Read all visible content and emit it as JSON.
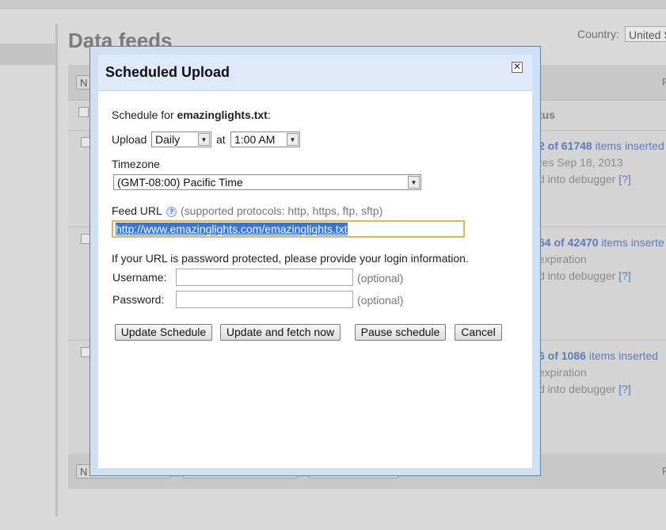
{
  "background": {
    "page_title": "Data feeds",
    "country_label": "Country:",
    "country_value": "United S",
    "toolbar_first_letter": "N",
    "col_f": "F",
    "status_heading": "tus",
    "rows": [
      {
        "items_count": "2 of 61748",
        "items_suffix": "items inserted",
        "line2": "res Sep 18, 2013",
        "line3": "d into debugger",
        "help": "[?]"
      },
      {
        "items_count": "64 of 42470",
        "items_suffix": "items inserte",
        "line2": "expiration",
        "line3": "d into debugger",
        "help": "[?]"
      },
      {
        "items_count": "6 of 1086",
        "items_suffix": "items inserted",
        "line2": "expiration",
        "line3": "d into debugger",
        "help": "[?]"
      }
    ]
  },
  "dialog": {
    "title": "Scheduled Upload",
    "close_glyph": "✕",
    "schedule_for_prefix": "Schedule for",
    "file_name": "emazinglights.txt",
    "schedule_for_suffix": ":",
    "upload_label": "Upload",
    "frequency": "Daily",
    "at_label": "at",
    "time": "1:00 AM",
    "timezone_label": "Timezone",
    "timezone": "(GMT-08:00) Pacific Time",
    "feed_url_label": "Feed URL",
    "help_glyph": "?",
    "protocols_note": "(supported protocols: http, https, ftp, sftp)",
    "feed_url_value": "http://www.emazinglights.com/emazinglights.txt",
    "password_note": "If your URL is password protected, please provide your login information.",
    "username_label": "Username:",
    "password_label": "Password:",
    "optional_label": "(optional)",
    "buttons": {
      "update_schedule": "Update Schedule",
      "update_fetch": "Update and fetch now",
      "pause": "Pause schedule",
      "cancel": "Cancel"
    }
  }
}
